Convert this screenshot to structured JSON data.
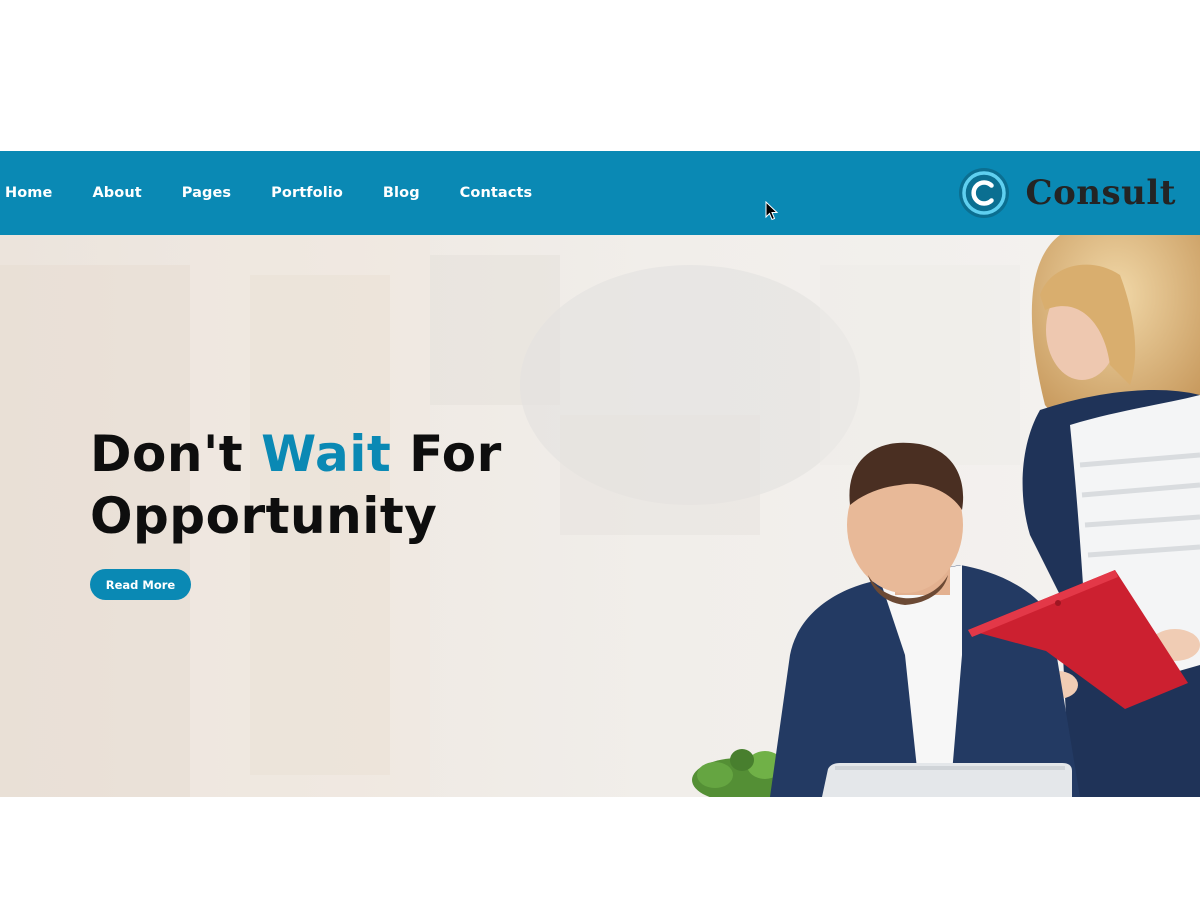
{
  "nav": {
    "items": [
      {
        "label": "Home"
      },
      {
        "label": "About"
      },
      {
        "label": "Pages"
      },
      {
        "label": "Portfolio"
      },
      {
        "label": "Blog"
      },
      {
        "label": "Contacts"
      }
    ],
    "brand_name": "Consult"
  },
  "hero": {
    "title_part1": "Don't ",
    "title_accent": "Wait",
    "title_part2": " For",
    "title_line2": "Opportunity",
    "cta_label": "Read More"
  },
  "colors": {
    "primary": "#0a89b4",
    "heading": "#0e0e0e",
    "brand_text": "#242424",
    "hero_background": "#efe9e3"
  },
  "icons": {
    "brand_logo": "c-ring-logo-icon",
    "pointer": "mouse-cursor-icon",
    "hero_image": "business-people-photo"
  }
}
